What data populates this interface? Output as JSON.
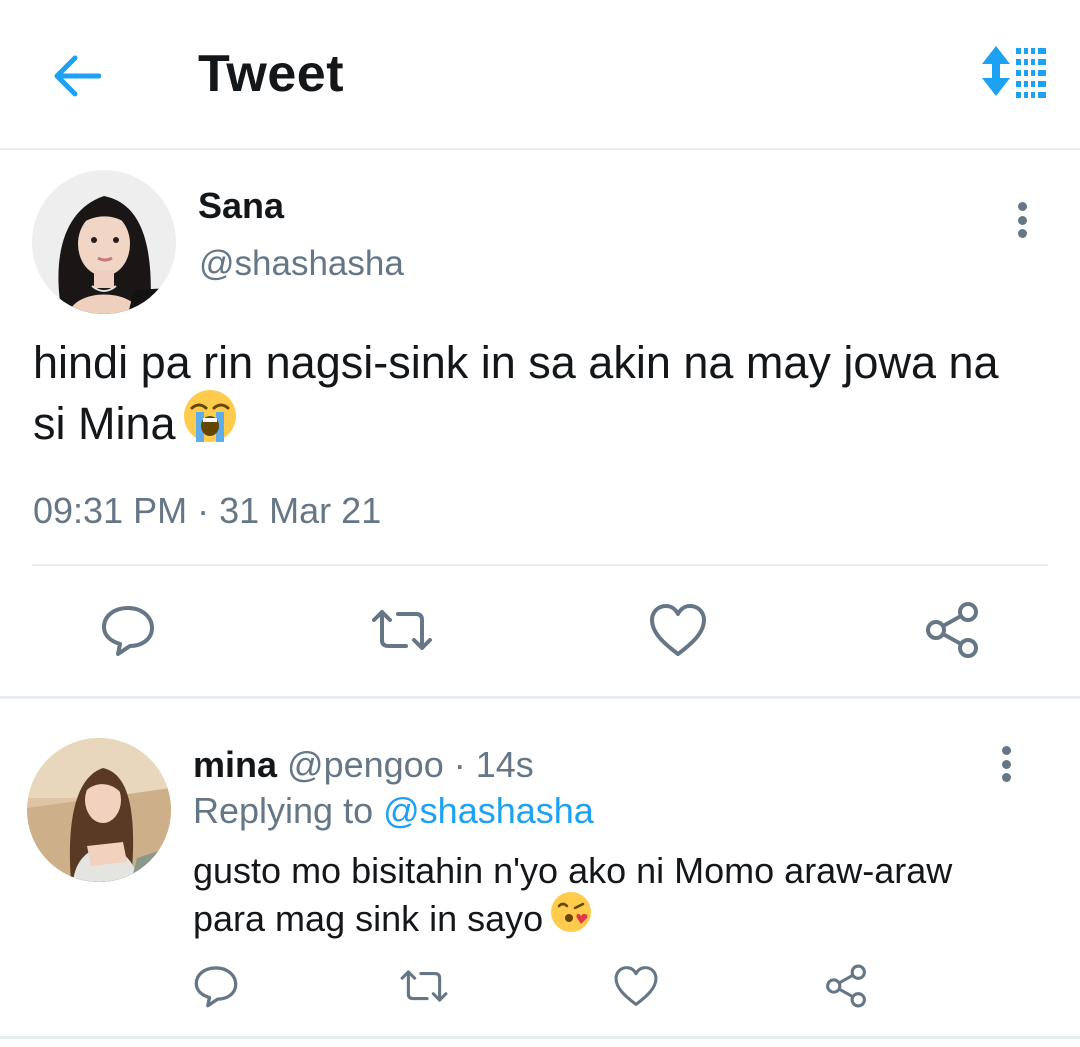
{
  "header": {
    "title": "Tweet",
    "back_icon": "arrow-left-icon",
    "sort_icon": "sort-list-icon",
    "accent_color": "#1da1f2"
  },
  "tweet": {
    "name": "Sana",
    "handle": "@shashasha",
    "text": "hindi pa rin nagsi-sink in sa akin na may jowa na si Mina",
    "emoji": "loudly-crying-face",
    "time": "09:31 PM",
    "date": "31 Mar 21",
    "separator": "·",
    "actions": [
      "reply-icon",
      "retweet-icon",
      "like-icon",
      "share-icon"
    ]
  },
  "reply": {
    "name": "mina",
    "handle": "@pengoo",
    "separator": "·",
    "age": "14s",
    "replying_prefix": "Replying to",
    "replying_to": "@shashasha",
    "text": "gusto mo bisitahin n'yo ako ni Momo araw-araw para mag sink in sayo",
    "emoji": "face-blowing-a-kiss",
    "actions": [
      "reply-icon",
      "retweet-icon",
      "like-icon",
      "share-icon"
    ]
  },
  "colors": {
    "text": "#14171a",
    "muted": "#657786",
    "link": "#1da1f2",
    "divider": "#e6ecf0"
  }
}
